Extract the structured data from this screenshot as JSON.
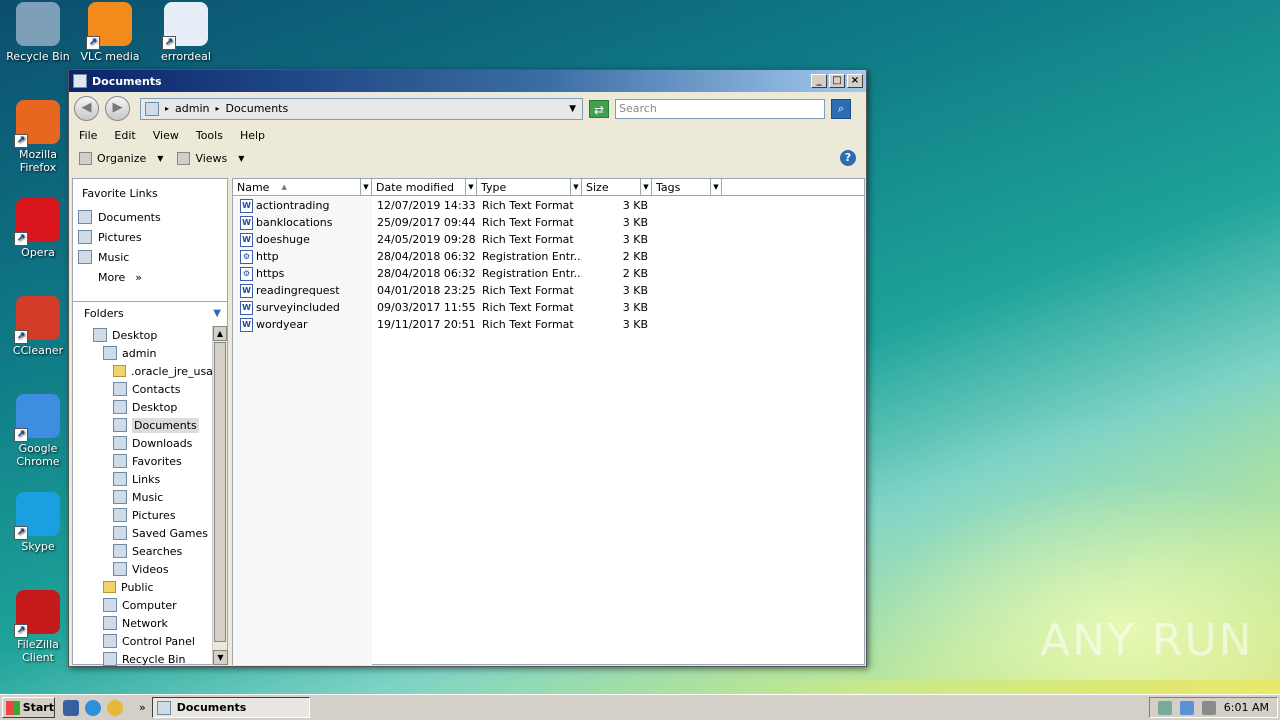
{
  "desktop": {
    "icons": [
      {
        "label": "Recycle Bin",
        "icon": "recycle-bin-icon",
        "color": "#7da0b8"
      },
      {
        "label": "VLC media",
        "icon": "vlc-icon",
        "color": "#f28a1c"
      },
      {
        "label": "errordeal",
        "icon": "word-document-icon",
        "color": "#e8eef7"
      },
      {
        "label": "Mozilla Firefox",
        "icon": "firefox-icon",
        "color": "#e8671e"
      },
      {
        "label": "Opera",
        "icon": "opera-icon",
        "color": "#d8161b"
      },
      {
        "label": "CCleaner",
        "icon": "ccleaner-icon",
        "color": "#d43c2a"
      },
      {
        "label": "Google Chrome",
        "icon": "chrome-icon",
        "color": "#3d8de0"
      },
      {
        "label": "Skype",
        "icon": "skype-icon",
        "color": "#1a9fe0"
      },
      {
        "label": "FileZilla Client",
        "icon": "filezilla-icon",
        "color": "#c41a1a"
      }
    ],
    "watermark": "ANY RUN"
  },
  "window": {
    "title": "Documents",
    "address": {
      "segments": [
        "admin",
        "Documents"
      ]
    },
    "search_placeholder": "Search",
    "menu": [
      "File",
      "Edit",
      "View",
      "Tools",
      "Help"
    ],
    "toolbar": {
      "organize": "Organize",
      "views": "Views"
    },
    "favorite_links": {
      "header": "Favorite Links",
      "items": [
        "Documents",
        "Pictures",
        "Music"
      ],
      "more": "More"
    },
    "folders": {
      "header": "Folders",
      "tree": [
        {
          "label": "Desktop",
          "level": 0
        },
        {
          "label": "admin",
          "level": 1
        },
        {
          "label": ".oracle_jre_usag",
          "level": 2
        },
        {
          "label": "Contacts",
          "level": 2
        },
        {
          "label": "Desktop",
          "level": 2
        },
        {
          "label": "Documents",
          "level": 2,
          "selected": true
        },
        {
          "label": "Downloads",
          "level": 2
        },
        {
          "label": "Favorites",
          "level": 2
        },
        {
          "label": "Links",
          "level": 2
        },
        {
          "label": "Music",
          "level": 2
        },
        {
          "label": "Pictures",
          "level": 2
        },
        {
          "label": "Saved Games",
          "level": 2
        },
        {
          "label": "Searches",
          "level": 2
        },
        {
          "label": "Videos",
          "level": 2
        },
        {
          "label": "Public",
          "level": 1
        },
        {
          "label": "Computer",
          "level": 1
        },
        {
          "label": "Network",
          "level": 1
        },
        {
          "label": "Control Panel",
          "level": 1
        },
        {
          "label": "Recycle Bin",
          "level": 1
        }
      ]
    },
    "columns": [
      "Name",
      "Date modified",
      "Type",
      "Size",
      "Tags"
    ],
    "files": [
      {
        "name": "actiontrading",
        "date": "12/07/2019 14:33",
        "type": "Rich Text Format",
        "size": "3 KB",
        "icon": "rtf-file-icon"
      },
      {
        "name": "banklocations",
        "date": "25/09/2017 09:44",
        "type": "Rich Text Format",
        "size": "3 KB",
        "icon": "rtf-file-icon"
      },
      {
        "name": "doeshuge",
        "date": "24/05/2019 09:28",
        "type": "Rich Text Format",
        "size": "3 KB",
        "icon": "rtf-file-icon"
      },
      {
        "name": "http",
        "date": "28/04/2018 06:32",
        "type": "Registration Entr...",
        "size": "2 KB",
        "icon": "registry-file-icon"
      },
      {
        "name": "https",
        "date": "28/04/2018 06:32",
        "type": "Registration Entr...",
        "size": "2 KB",
        "icon": "registry-file-icon"
      },
      {
        "name": "readingrequest",
        "date": "04/01/2018 23:25",
        "type": "Rich Text Format",
        "size": "3 KB",
        "icon": "rtf-file-icon"
      },
      {
        "name": "surveyincluded",
        "date": "09/03/2017 11:55",
        "type": "Rich Text Format",
        "size": "3 KB",
        "icon": "rtf-file-icon"
      },
      {
        "name": "wordyear",
        "date": "19/11/2017 20:51",
        "type": "Rich Text Format",
        "size": "3 KB",
        "icon": "rtf-file-icon"
      }
    ]
  },
  "taskbar": {
    "start": "Start",
    "task": "Documents",
    "clock": "6:01 AM"
  }
}
